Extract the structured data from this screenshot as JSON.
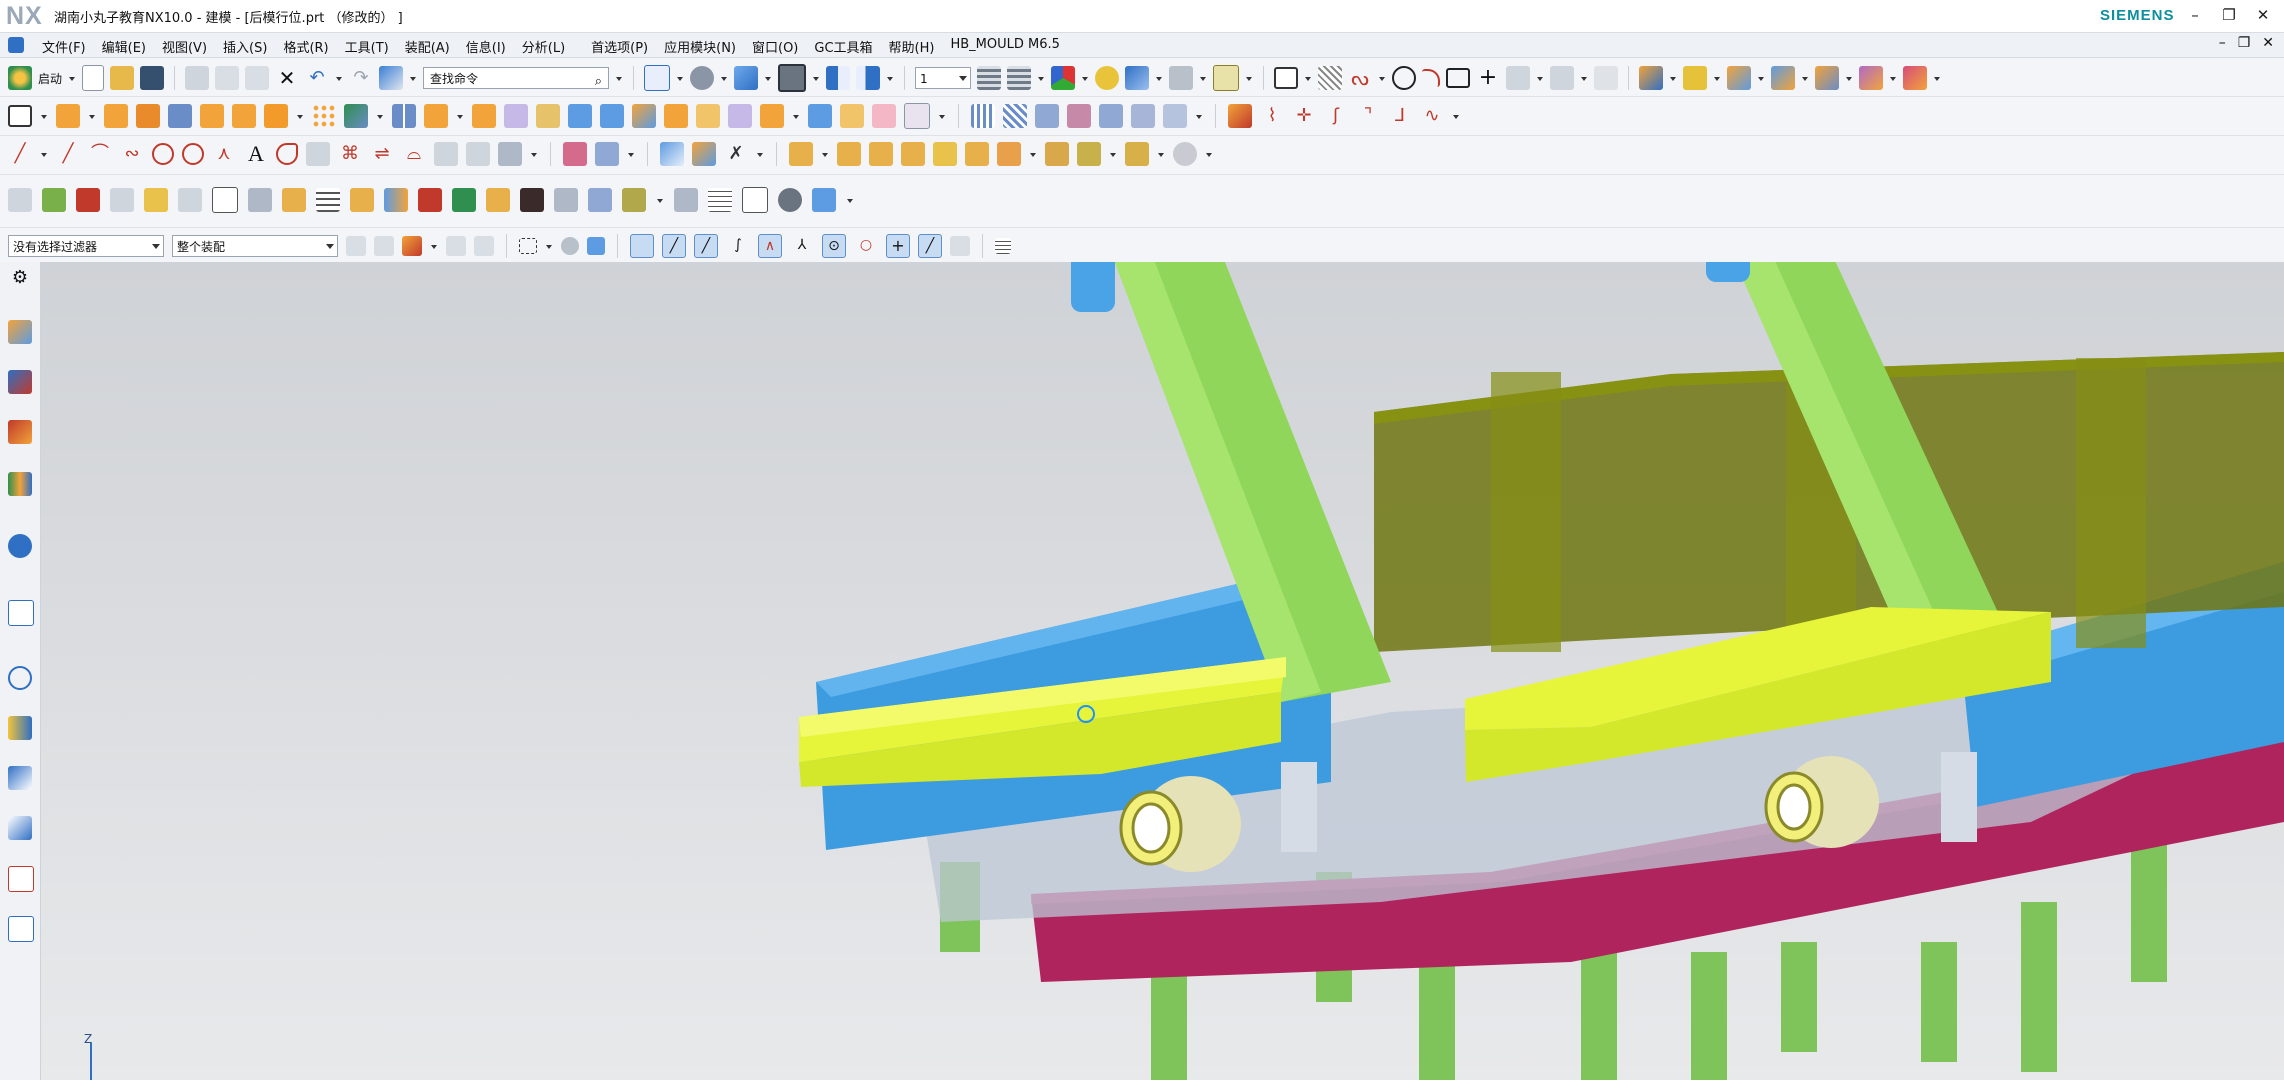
{
  "titlebar": {
    "logo": "NX",
    "title": "湖南小丸子教育NX10.0 - 建模 - [后模行位.prt （修改的） ]",
    "brand": "SIEMENS",
    "minimize": "–",
    "restore": "❐",
    "close": "✕"
  },
  "menubar": {
    "items": [
      {
        "label": "文件(F)"
      },
      {
        "label": "编辑(E)"
      },
      {
        "label": "视图(V)"
      },
      {
        "label": "插入(S)"
      },
      {
        "label": "格式(R)"
      },
      {
        "label": "工具(T)"
      },
      {
        "label": "装配(A)"
      },
      {
        "label": "信息(I)"
      },
      {
        "label": "分析(L)"
      },
      {
        "label": "首选项(P)"
      },
      {
        "label": "应用模块(N)"
      },
      {
        "label": "窗口(O)"
      },
      {
        "label": "GC工具箱"
      },
      {
        "label": "帮助(H)"
      },
      {
        "label": "HB_MOULD M6.5"
      }
    ],
    "doc_minimize": "–",
    "doc_restore": "❐",
    "doc_close": "✕"
  },
  "toolbar1": {
    "start_label": "启动",
    "search_placeholder": "查找命令",
    "layer_value": "1"
  },
  "filterbar": {
    "selection_filter": "没有选择过滤器",
    "assembly_scope": "整个装配"
  },
  "triad": {
    "axis_label": "Z"
  },
  "colors": {
    "accent": "#2f6fc4",
    "brand": "#0d8fa0",
    "model_green": "#8fd65a",
    "model_yellow": "#d9ef2a",
    "model_blue": "#3d9be0",
    "model_olive": "#6e7610",
    "model_magenta": "#b0245e"
  }
}
